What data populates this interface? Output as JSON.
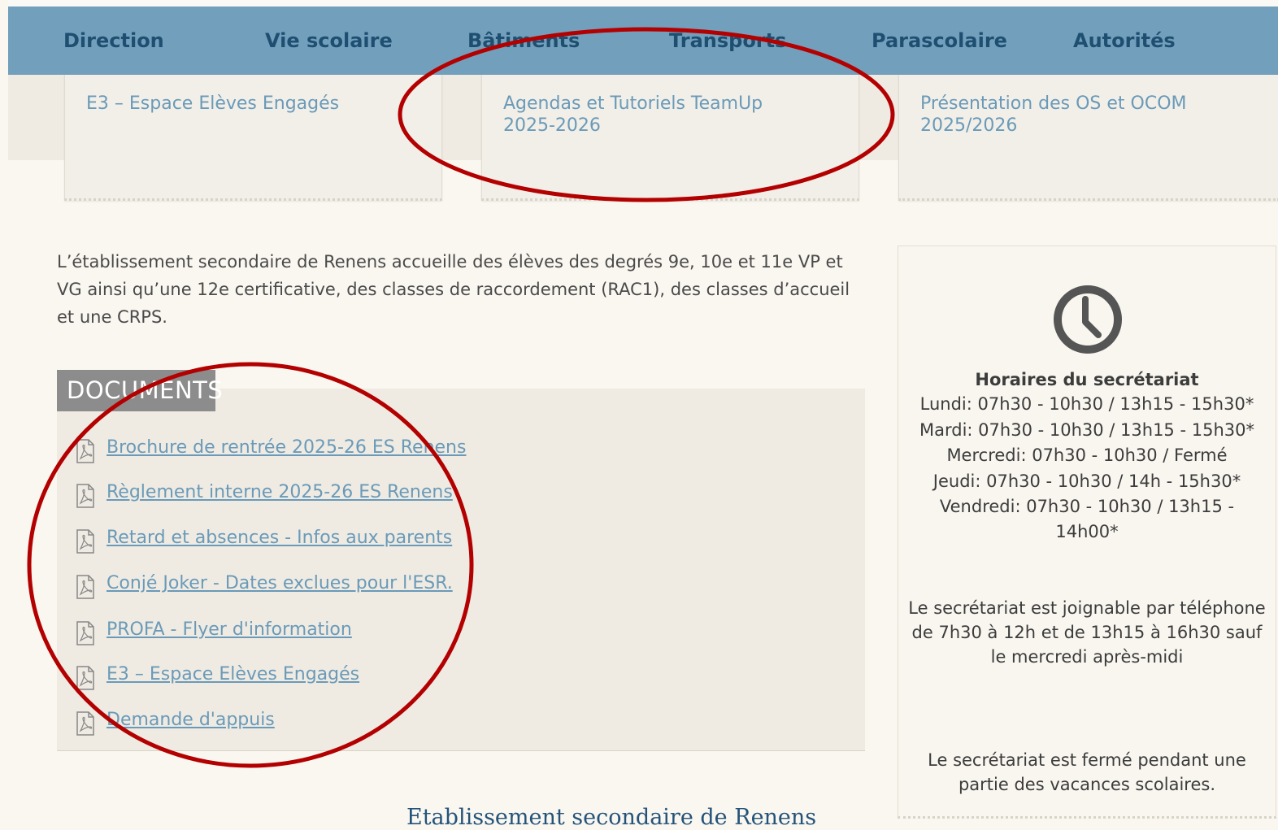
{
  "nav": {
    "items": [
      {
        "label": "Direction"
      },
      {
        "label": "Vie scolaire"
      },
      {
        "label": "Bâtiments"
      },
      {
        "label": "Transports"
      },
      {
        "label": "Parascolaire"
      },
      {
        "label": "Autorités"
      }
    ]
  },
  "cards": [
    {
      "title": "E3 – Espace Elèves Engagés"
    },
    {
      "title": "Agendas et Tutoriels TeamUp 2025-2026"
    },
    {
      "title": "Présentation des OS et OCOM 2025/2026"
    }
  ],
  "intro": {
    "text": "L’établissement secondaire de Renens accueille des élèves des degrés 9e, 10e et 11e VP et VG ainsi qu’une 12e certificative, des classes de raccordement (RAC1), des classes d’accueil et une CRPS."
  },
  "documents": {
    "title": "DOCUMENTS",
    "items": [
      {
        "label": "Brochure de rentrée 2025-26 ES Renens"
      },
      {
        "label": "Règlement interne 2025-26 ES Renens"
      },
      {
        "label": "Retard et absences - Infos aux parents"
      },
      {
        "label": "Conjé Joker - Dates exclues pour l'ESR."
      },
      {
        "label": "PROFA - Flyer d'information"
      },
      {
        "label": "E3 – Espace Elèves Engagés"
      },
      {
        "label": "Demande d'appuis"
      }
    ]
  },
  "sidebar": {
    "hours_title": "Horaires du secrétariat",
    "hours": [
      "Lundi: 07h30 - 10h30 / 13h15 - 15h30*",
      "Mardi: 07h30 - 10h30 / 13h15 - 15h30*",
      "Mercredi: 07h30 - 10h30 / Fermé",
      "Jeudi: 07h30 - 10h30 / 14h - 15h30*",
      "Vendredi: 07h30 - 10h30 / 13h15 -",
      "14h00*"
    ],
    "phone_info": "Le secrétariat est joignable par téléphone de 7h30 à 12h et de 13h15 à 16h30 sauf le mercredi après-midi",
    "closed_info": "Le secrétariat est fermé pendant une partie des vacances scolaires."
  },
  "footer": {
    "title": "Etablissement secondaire de Renens"
  },
  "colors": {
    "nav_bg": "#729fbc",
    "nav_text": "#1f4f70",
    "link": "#6a9ab8",
    "annotation": "#b30000"
  }
}
